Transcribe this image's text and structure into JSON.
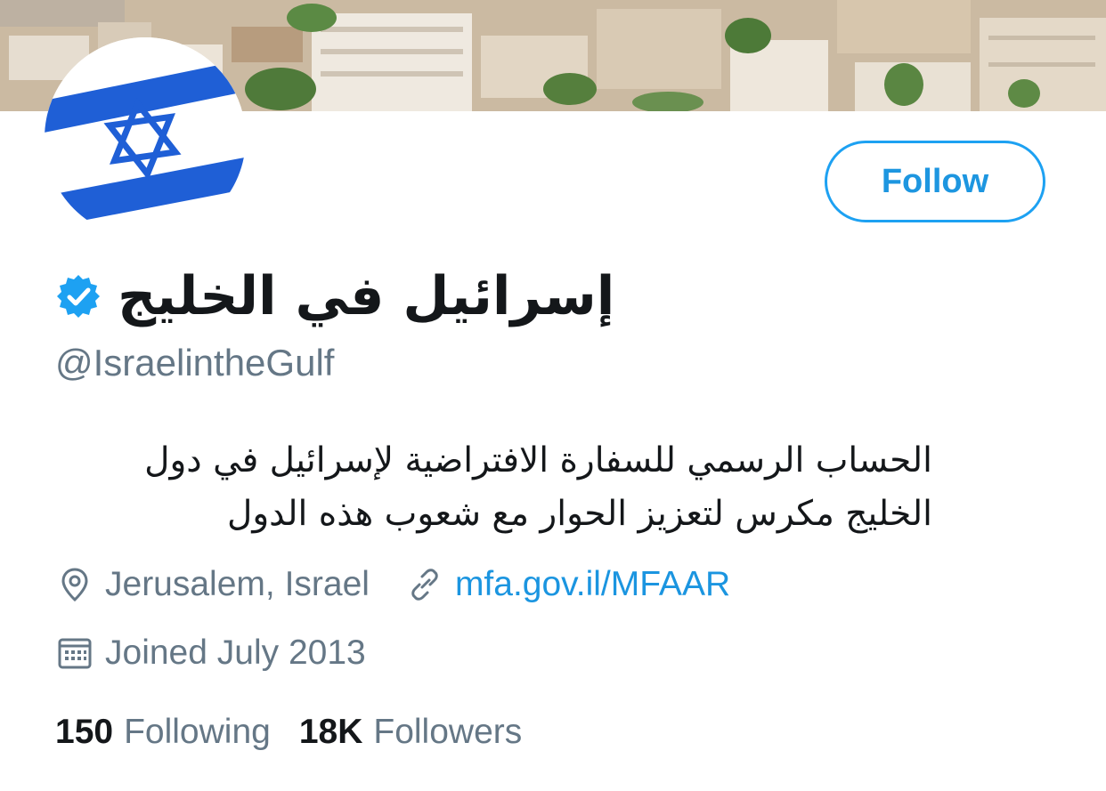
{
  "profile": {
    "display_name": "إسرائيل في الخليج",
    "handle": "@IsraelintheGulf",
    "bio": "الحساب الرسمي للسفارة الافتراضية لإسرائيل في دول الخليج مكرس لتعزيز الحوار مع شعوب هذه الدول",
    "location": "Jerusalem, Israel",
    "website": "mfa.gov.il/MFAAR",
    "joined": "Joined July 2013"
  },
  "actions": {
    "follow_label": "Follow"
  },
  "stats": {
    "following_count": "150",
    "following_label": "Following",
    "followers_count": "18K",
    "followers_label": "Followers"
  },
  "icons": {
    "verified": "verified-badge-icon",
    "location": "location-pin-icon",
    "link": "link-icon",
    "calendar": "calendar-icon"
  },
  "colors": {
    "accent": "#1da1f2",
    "link": "#1b95e0",
    "text_primary": "#14171a",
    "text_secondary": "#657786",
    "flag_blue": "#1f5fd6"
  }
}
